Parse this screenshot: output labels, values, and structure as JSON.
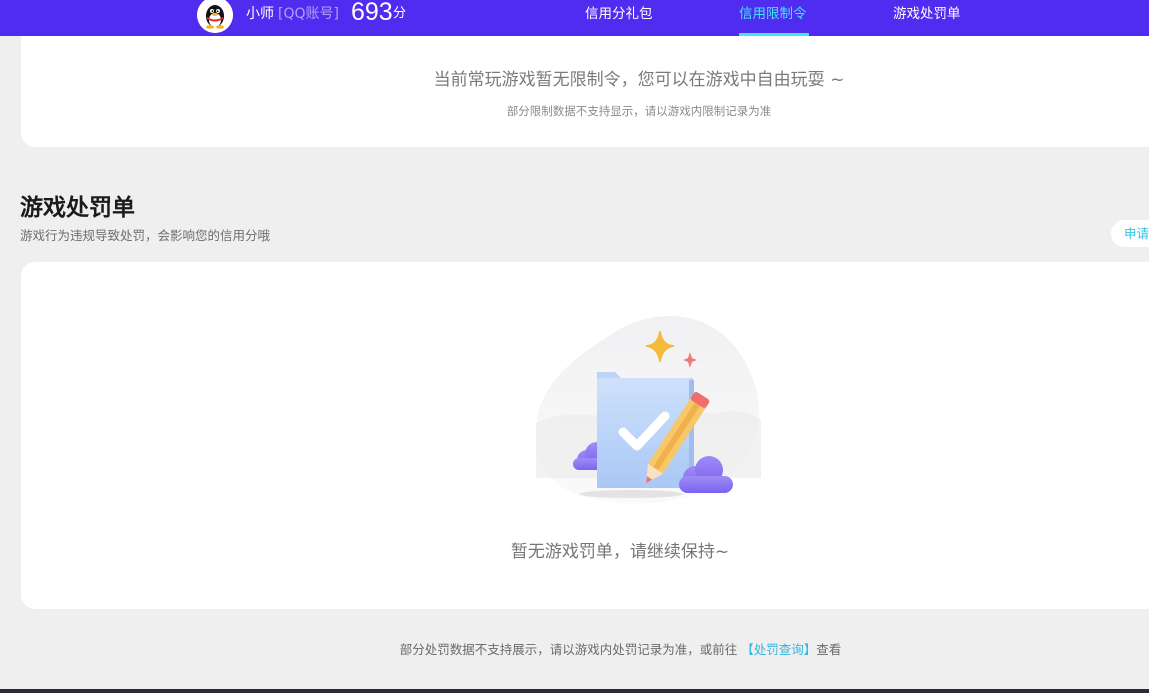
{
  "header": {
    "user_name": "小师",
    "account_type": "[QQ账号]",
    "score_value": "693",
    "score_unit": "分",
    "tabs": [
      {
        "label": "信用分礼包",
        "active": false
      },
      {
        "label": "信用限制令",
        "active": true
      },
      {
        "label": "游戏处罚单",
        "active": false
      }
    ],
    "accent_color": "#4f2cf0",
    "active_tab_color": "#3ee8f2"
  },
  "restriction": {
    "message": "当前常玩游戏暂无限制令，您可以在游戏中自由玩耍 ~",
    "note": "部分限制数据不支持显示，请以游戏内限制记录为准"
  },
  "penalty": {
    "title": "游戏处罚单",
    "subtitle": "游戏行为违规导致处罚，会影响您的信用分哦",
    "apply_label": "申请",
    "empty_text": "暂无游戏罚单，请继续保持~"
  },
  "footer": {
    "prefix": "部分处罚数据不支持展示，请以游戏内处罚记录为准，或前往",
    "link": "【处罚查询】",
    "suffix": "查看"
  }
}
